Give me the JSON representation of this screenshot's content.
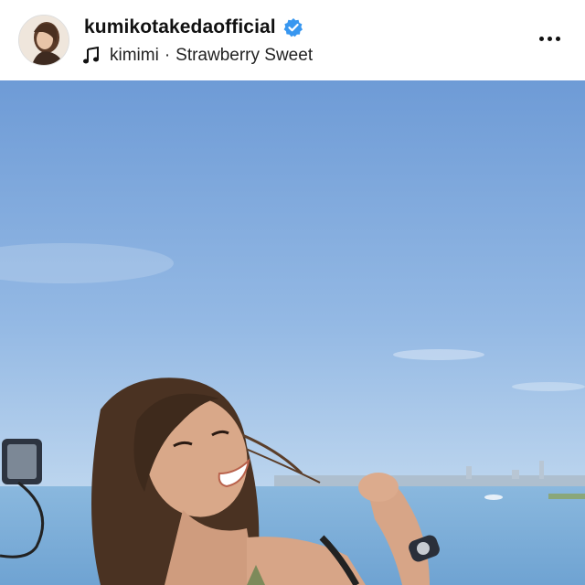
{
  "post_header": {
    "username": "kumikotakedaofficial",
    "verified": true,
    "music": {
      "artist": "kimimi",
      "separator": "·",
      "track": "Strawberry Sweet"
    },
    "more_icon": "more-horizontal-icon",
    "music_icon": "music-note-icon",
    "verified_icon": "verified-badge-icon"
  },
  "colors": {
    "verified_blue": "#3897f0",
    "sky_top": "#6e9bd6",
    "sky_bottom": "#b9d3ee",
    "sea": "#7fb0da"
  }
}
